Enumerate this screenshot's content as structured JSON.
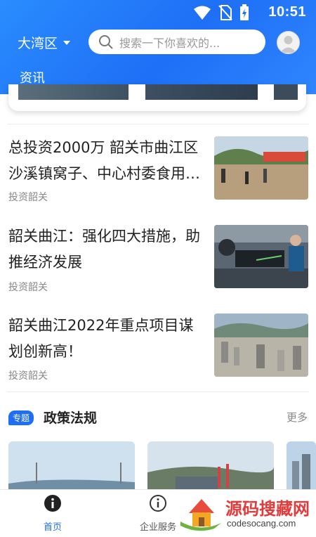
{
  "status_bar": {
    "time": "10:51"
  },
  "header": {
    "region": "大湾区",
    "search_placeholder": "搜索一下你喜欢的...",
    "tab": "资讯"
  },
  "news": [
    {
      "title": "总投资2000万 韶关市曲江区沙溪镇窝子、中心村委食用…",
      "source": "投资韶关"
    },
    {
      "title": "韶关曲江：强化四大措施，助推经济发展",
      "source": "投资韶关"
    },
    {
      "title": "韶关曲江2022年重点项目谋划创新高！",
      "source": "投资韶关"
    }
  ],
  "section": {
    "tag": "专题",
    "title": "政策法规",
    "more": "更多"
  },
  "bottom_nav": [
    {
      "label": "首页",
      "active": true
    },
    {
      "label": "企业服务",
      "active": false
    }
  ],
  "watermark": {
    "brand": "源码搜藏网",
    "url": "codesocang.com"
  },
  "colors": {
    "primary": "#1e6ff5",
    "text": "#222222",
    "muted": "#888888"
  }
}
